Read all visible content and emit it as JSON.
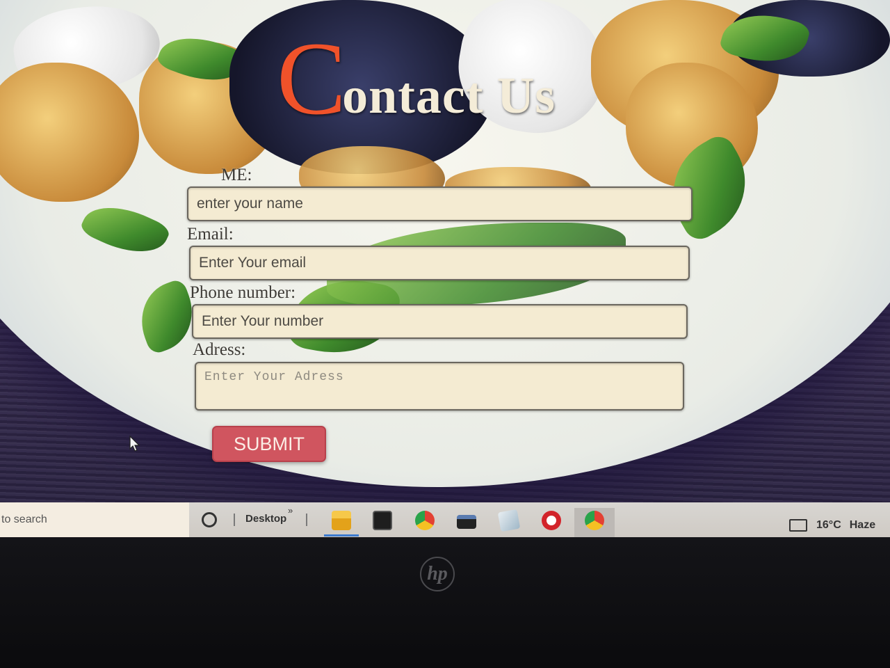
{
  "page": {
    "title_first_letter": "C",
    "title_rest": "ontact Us"
  },
  "form": {
    "name_label": "ME:",
    "name_placeholder": "enter your name",
    "email_label": "Email:",
    "email_placeholder": "Enter Your email",
    "phone_label": "Phone number:",
    "phone_placeholder": "Enter Your number",
    "address_label": "Adress:",
    "address_placeholder": "Enter Your Adress",
    "submit_label": "SUBMIT"
  },
  "taskbar": {
    "search_text": "to search",
    "desktop_label": "Desktop",
    "overflow_chevron": "»",
    "apps": [
      "file-explorer-icon",
      "terminal-icon",
      "chrome-icon",
      "app-icon",
      "notes-icon",
      "opera-icon",
      "chrome-profile-icon"
    ],
    "weather_temp": "16°C",
    "weather_condition": "Haze"
  },
  "bezel": {
    "logo": "hp"
  },
  "colors": {
    "title_accent": "#f0522a",
    "submit_bg": "#d0555f",
    "field_bg": "#f4ebd2"
  }
}
